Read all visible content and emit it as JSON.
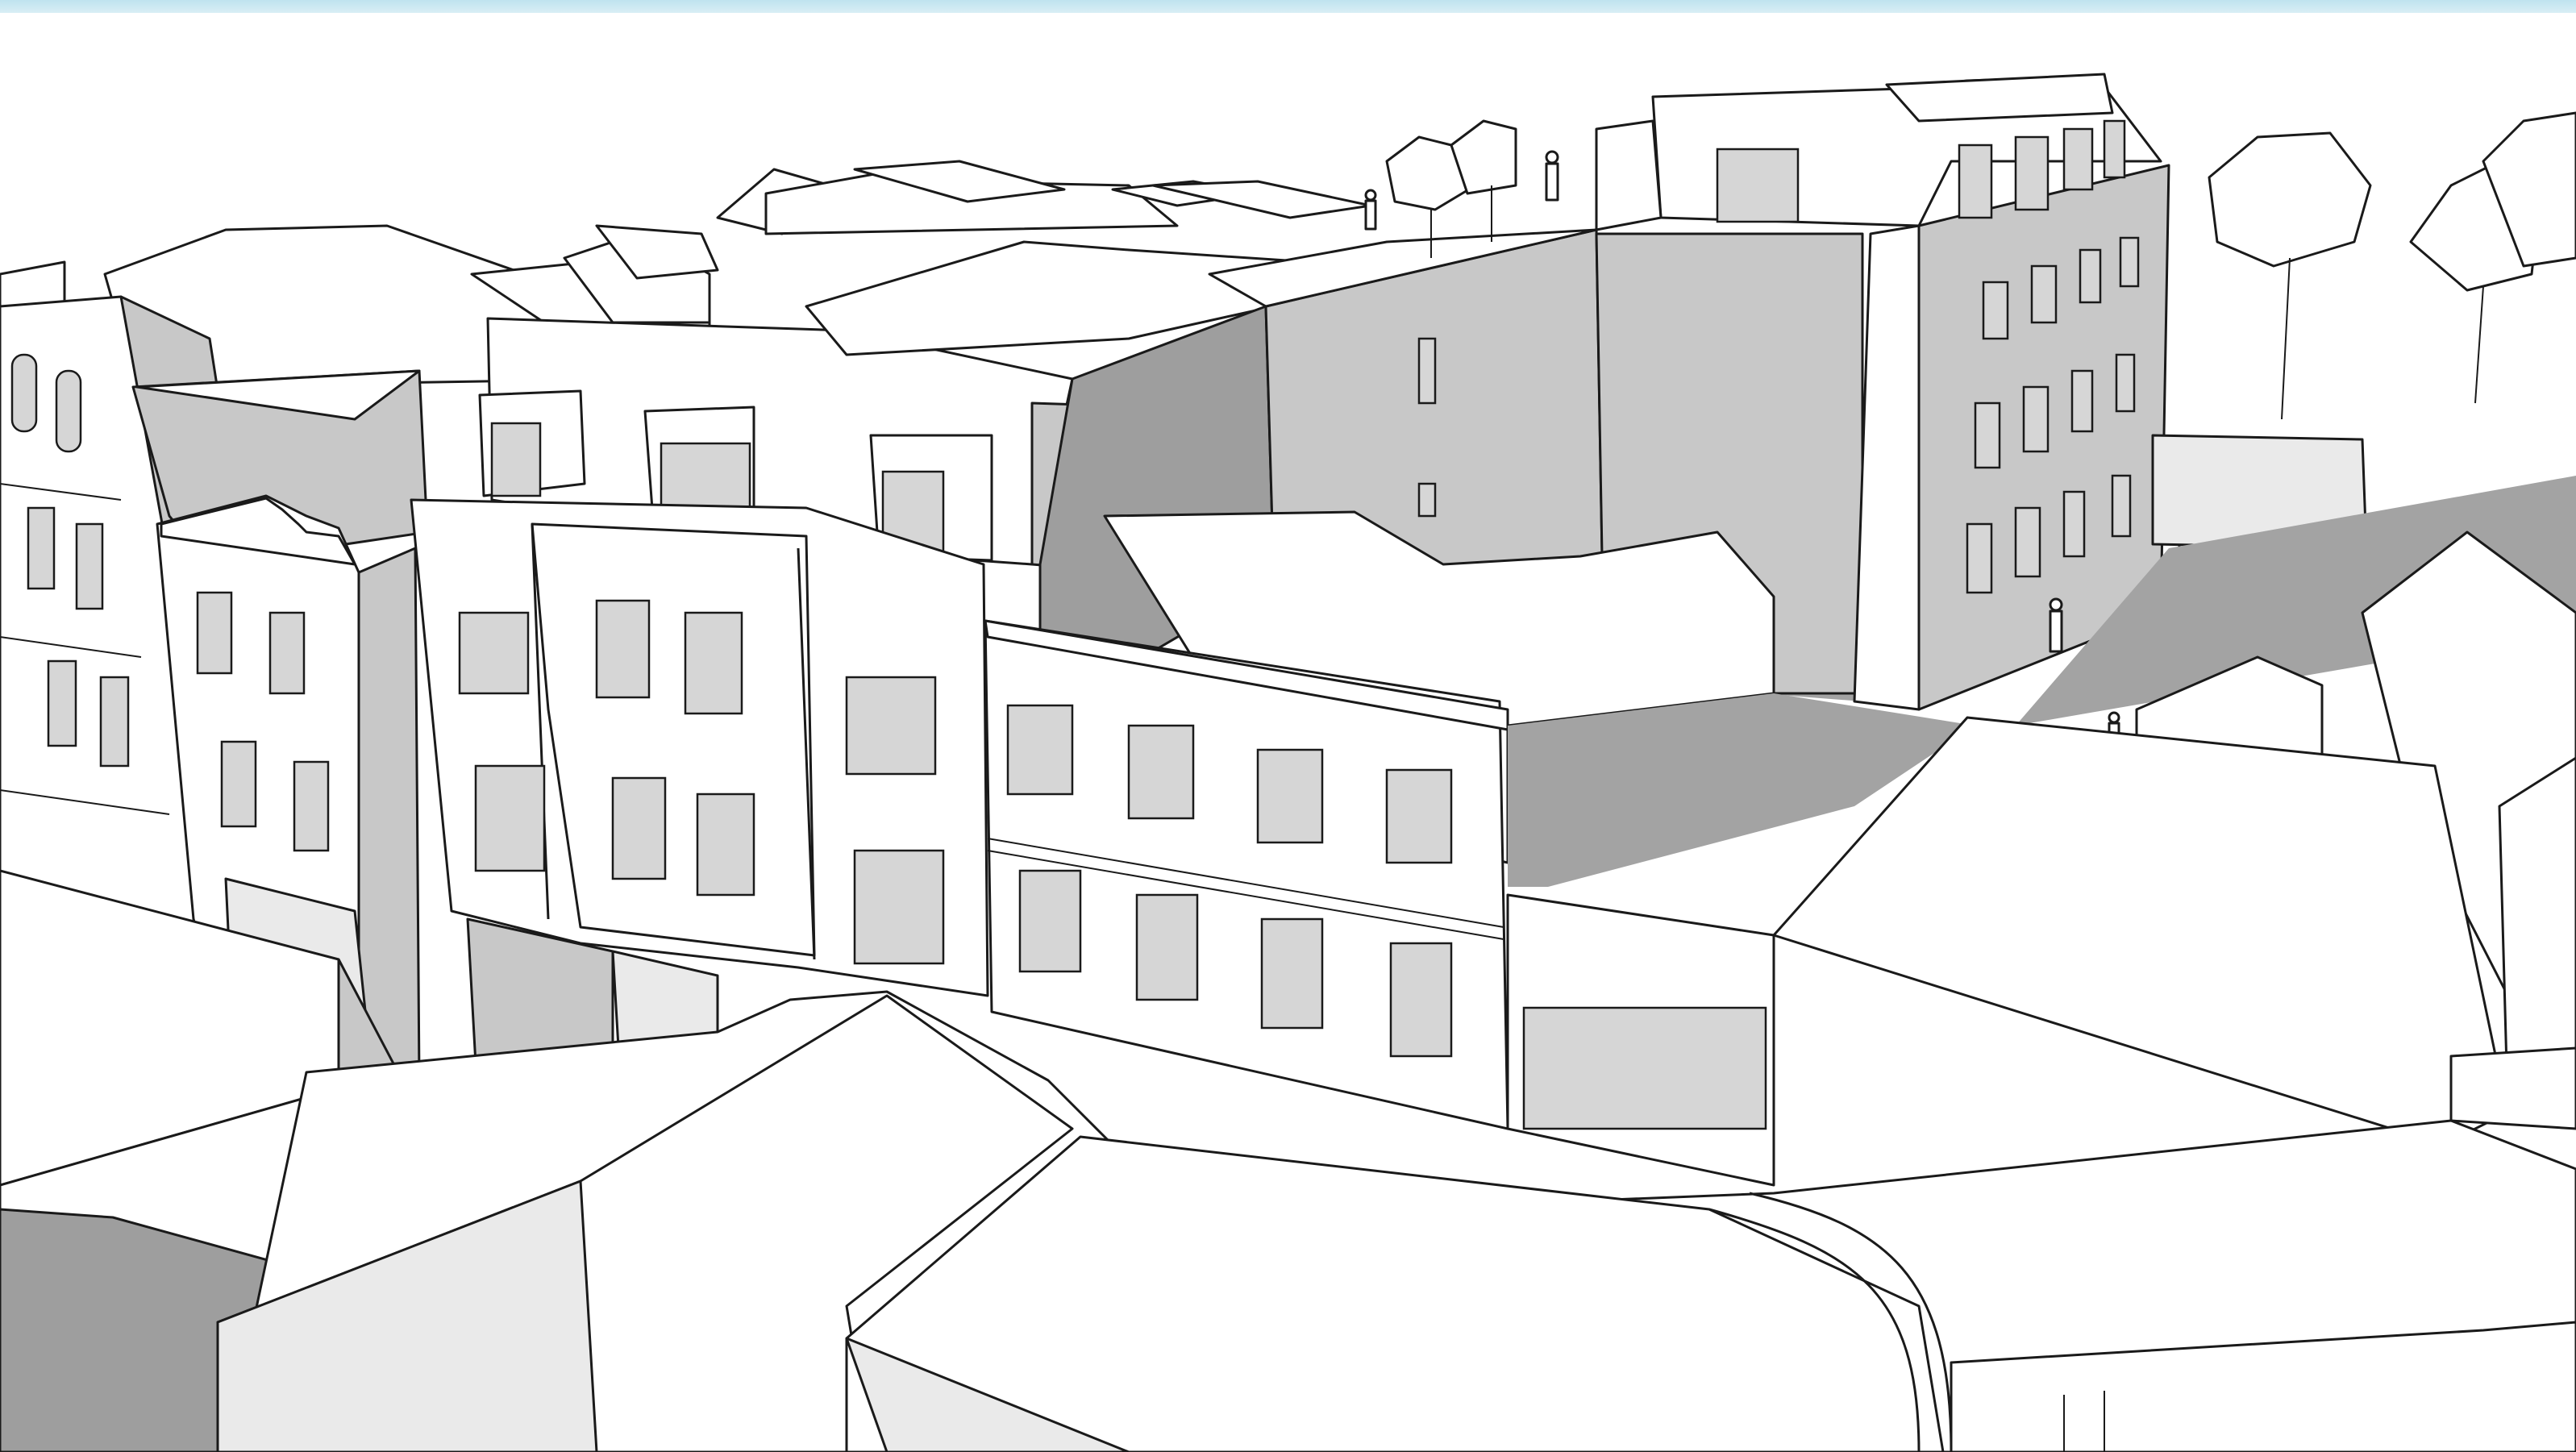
{
  "viewport": {
    "kind": "3d-model-viewport",
    "background_color": "#ffffff",
    "sky_strip_color": "#cce8f2",
    "shadow_color": "#a3a3a3",
    "edge_color": "#1a1a1a"
  }
}
